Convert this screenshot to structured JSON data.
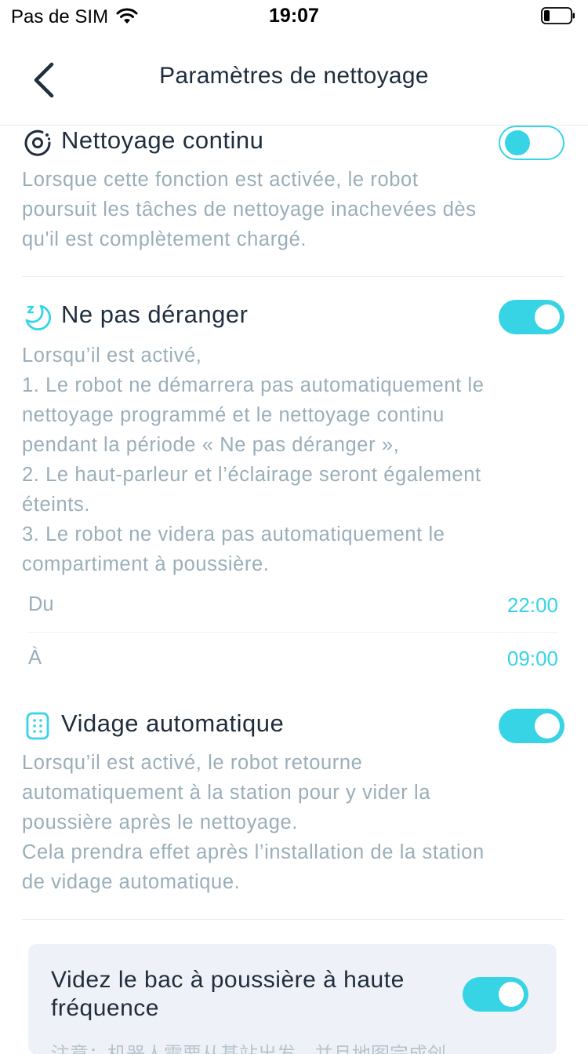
{
  "status_bar": {
    "carrier": "Pas de SIM",
    "time": "19:07"
  },
  "header": {
    "title": "Paramètres de nettoyage"
  },
  "sections": {
    "continuous": {
      "title": "Nettoyage continu",
      "enabled": false,
      "description": "Lorsque cette fonction est activée, le robot\npoursuit les tâches de nettoyage inachevées dès\nqu'il est complètement chargé."
    },
    "dnd": {
      "title": "Ne pas déranger",
      "enabled": true,
      "description": "Lorsqu’il est activé,\n1. Le robot ne démarrera pas automatiquement le\nnettoyage programmé et le nettoyage continu\npendant la période « Ne pas déranger »,\n2. Le haut-parleur et l’éclairage seront également\néteints.\n 3. Le robot ne videra pas automatiquement le\ncompartiment à poussière.",
      "from_label": "Du",
      "from_value": "22:00",
      "to_label": "À",
      "to_value": "09:00"
    },
    "auto_empty": {
      "title": "Vidage automatique",
      "enabled": true,
      "description": "Lorsqu’il est activé, le robot retourne\nautomatiquement à la station pour y vider la\npoussière après le nettoyage.\nCela prendra effet après l’installation de la station\nde vidage automatique."
    },
    "high_frequency": {
      "title": "Videz le bac à poussière à haute fréquence",
      "enabled": true,
      "note": "注意：机器人需要从基站出发，并且地图完成创"
    }
  },
  "colors": {
    "accent": "#37d4e6",
    "text_primary": "#1f2d3d",
    "text_secondary": "#9aaeb9",
    "card_bg": "#eef2f8"
  },
  "icons": [
    "back-arrow-icon",
    "continuous-clean-icon",
    "moon-icon",
    "dust-bin-icon",
    "wifi-icon",
    "battery-icon"
  ]
}
